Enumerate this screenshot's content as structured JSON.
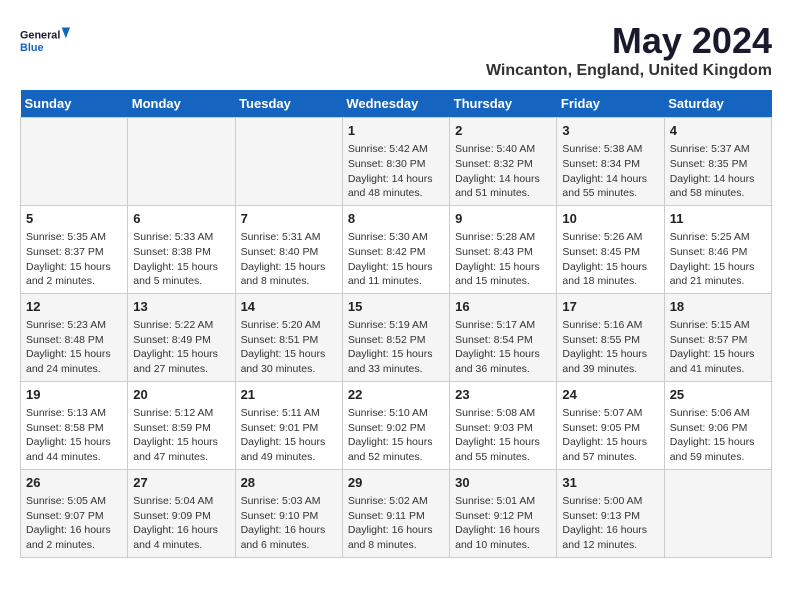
{
  "logo": {
    "line1": "General",
    "line2": "Blue"
  },
  "title": "May 2024",
  "subtitle": "Wincanton, England, United Kingdom",
  "days_header": [
    "Sunday",
    "Monday",
    "Tuesday",
    "Wednesday",
    "Thursday",
    "Friday",
    "Saturday"
  ],
  "weeks": [
    [
      {
        "day": "",
        "content": ""
      },
      {
        "day": "",
        "content": ""
      },
      {
        "day": "",
        "content": ""
      },
      {
        "day": "1",
        "content": "Sunrise: 5:42 AM\nSunset: 8:30 PM\nDaylight: 14 hours\nand 48 minutes."
      },
      {
        "day": "2",
        "content": "Sunrise: 5:40 AM\nSunset: 8:32 PM\nDaylight: 14 hours\nand 51 minutes."
      },
      {
        "day": "3",
        "content": "Sunrise: 5:38 AM\nSunset: 8:34 PM\nDaylight: 14 hours\nand 55 minutes."
      },
      {
        "day": "4",
        "content": "Sunrise: 5:37 AM\nSunset: 8:35 PM\nDaylight: 14 hours\nand 58 minutes."
      }
    ],
    [
      {
        "day": "5",
        "content": "Sunrise: 5:35 AM\nSunset: 8:37 PM\nDaylight: 15 hours\nand 2 minutes."
      },
      {
        "day": "6",
        "content": "Sunrise: 5:33 AM\nSunset: 8:38 PM\nDaylight: 15 hours\nand 5 minutes."
      },
      {
        "day": "7",
        "content": "Sunrise: 5:31 AM\nSunset: 8:40 PM\nDaylight: 15 hours\nand 8 minutes."
      },
      {
        "day": "8",
        "content": "Sunrise: 5:30 AM\nSunset: 8:42 PM\nDaylight: 15 hours\nand 11 minutes."
      },
      {
        "day": "9",
        "content": "Sunrise: 5:28 AM\nSunset: 8:43 PM\nDaylight: 15 hours\nand 15 minutes."
      },
      {
        "day": "10",
        "content": "Sunrise: 5:26 AM\nSunset: 8:45 PM\nDaylight: 15 hours\nand 18 minutes."
      },
      {
        "day": "11",
        "content": "Sunrise: 5:25 AM\nSunset: 8:46 PM\nDaylight: 15 hours\nand 21 minutes."
      }
    ],
    [
      {
        "day": "12",
        "content": "Sunrise: 5:23 AM\nSunset: 8:48 PM\nDaylight: 15 hours\nand 24 minutes."
      },
      {
        "day": "13",
        "content": "Sunrise: 5:22 AM\nSunset: 8:49 PM\nDaylight: 15 hours\nand 27 minutes."
      },
      {
        "day": "14",
        "content": "Sunrise: 5:20 AM\nSunset: 8:51 PM\nDaylight: 15 hours\nand 30 minutes."
      },
      {
        "day": "15",
        "content": "Sunrise: 5:19 AM\nSunset: 8:52 PM\nDaylight: 15 hours\nand 33 minutes."
      },
      {
        "day": "16",
        "content": "Sunrise: 5:17 AM\nSunset: 8:54 PM\nDaylight: 15 hours\nand 36 minutes."
      },
      {
        "day": "17",
        "content": "Sunrise: 5:16 AM\nSunset: 8:55 PM\nDaylight: 15 hours\nand 39 minutes."
      },
      {
        "day": "18",
        "content": "Sunrise: 5:15 AM\nSunset: 8:57 PM\nDaylight: 15 hours\nand 41 minutes."
      }
    ],
    [
      {
        "day": "19",
        "content": "Sunrise: 5:13 AM\nSunset: 8:58 PM\nDaylight: 15 hours\nand 44 minutes."
      },
      {
        "day": "20",
        "content": "Sunrise: 5:12 AM\nSunset: 8:59 PM\nDaylight: 15 hours\nand 47 minutes."
      },
      {
        "day": "21",
        "content": "Sunrise: 5:11 AM\nSunset: 9:01 PM\nDaylight: 15 hours\nand 49 minutes."
      },
      {
        "day": "22",
        "content": "Sunrise: 5:10 AM\nSunset: 9:02 PM\nDaylight: 15 hours\nand 52 minutes."
      },
      {
        "day": "23",
        "content": "Sunrise: 5:08 AM\nSunset: 9:03 PM\nDaylight: 15 hours\nand 55 minutes."
      },
      {
        "day": "24",
        "content": "Sunrise: 5:07 AM\nSunset: 9:05 PM\nDaylight: 15 hours\nand 57 minutes."
      },
      {
        "day": "25",
        "content": "Sunrise: 5:06 AM\nSunset: 9:06 PM\nDaylight: 15 hours\nand 59 minutes."
      }
    ],
    [
      {
        "day": "26",
        "content": "Sunrise: 5:05 AM\nSunset: 9:07 PM\nDaylight: 16 hours\nand 2 minutes."
      },
      {
        "day": "27",
        "content": "Sunrise: 5:04 AM\nSunset: 9:09 PM\nDaylight: 16 hours\nand 4 minutes."
      },
      {
        "day": "28",
        "content": "Sunrise: 5:03 AM\nSunset: 9:10 PM\nDaylight: 16 hours\nand 6 minutes."
      },
      {
        "day": "29",
        "content": "Sunrise: 5:02 AM\nSunset: 9:11 PM\nDaylight: 16 hours\nand 8 minutes."
      },
      {
        "day": "30",
        "content": "Sunrise: 5:01 AM\nSunset: 9:12 PM\nDaylight: 16 hours\nand 10 minutes."
      },
      {
        "day": "31",
        "content": "Sunrise: 5:00 AM\nSunset: 9:13 PM\nDaylight: 16 hours\nand 12 minutes."
      },
      {
        "day": "",
        "content": ""
      }
    ]
  ]
}
